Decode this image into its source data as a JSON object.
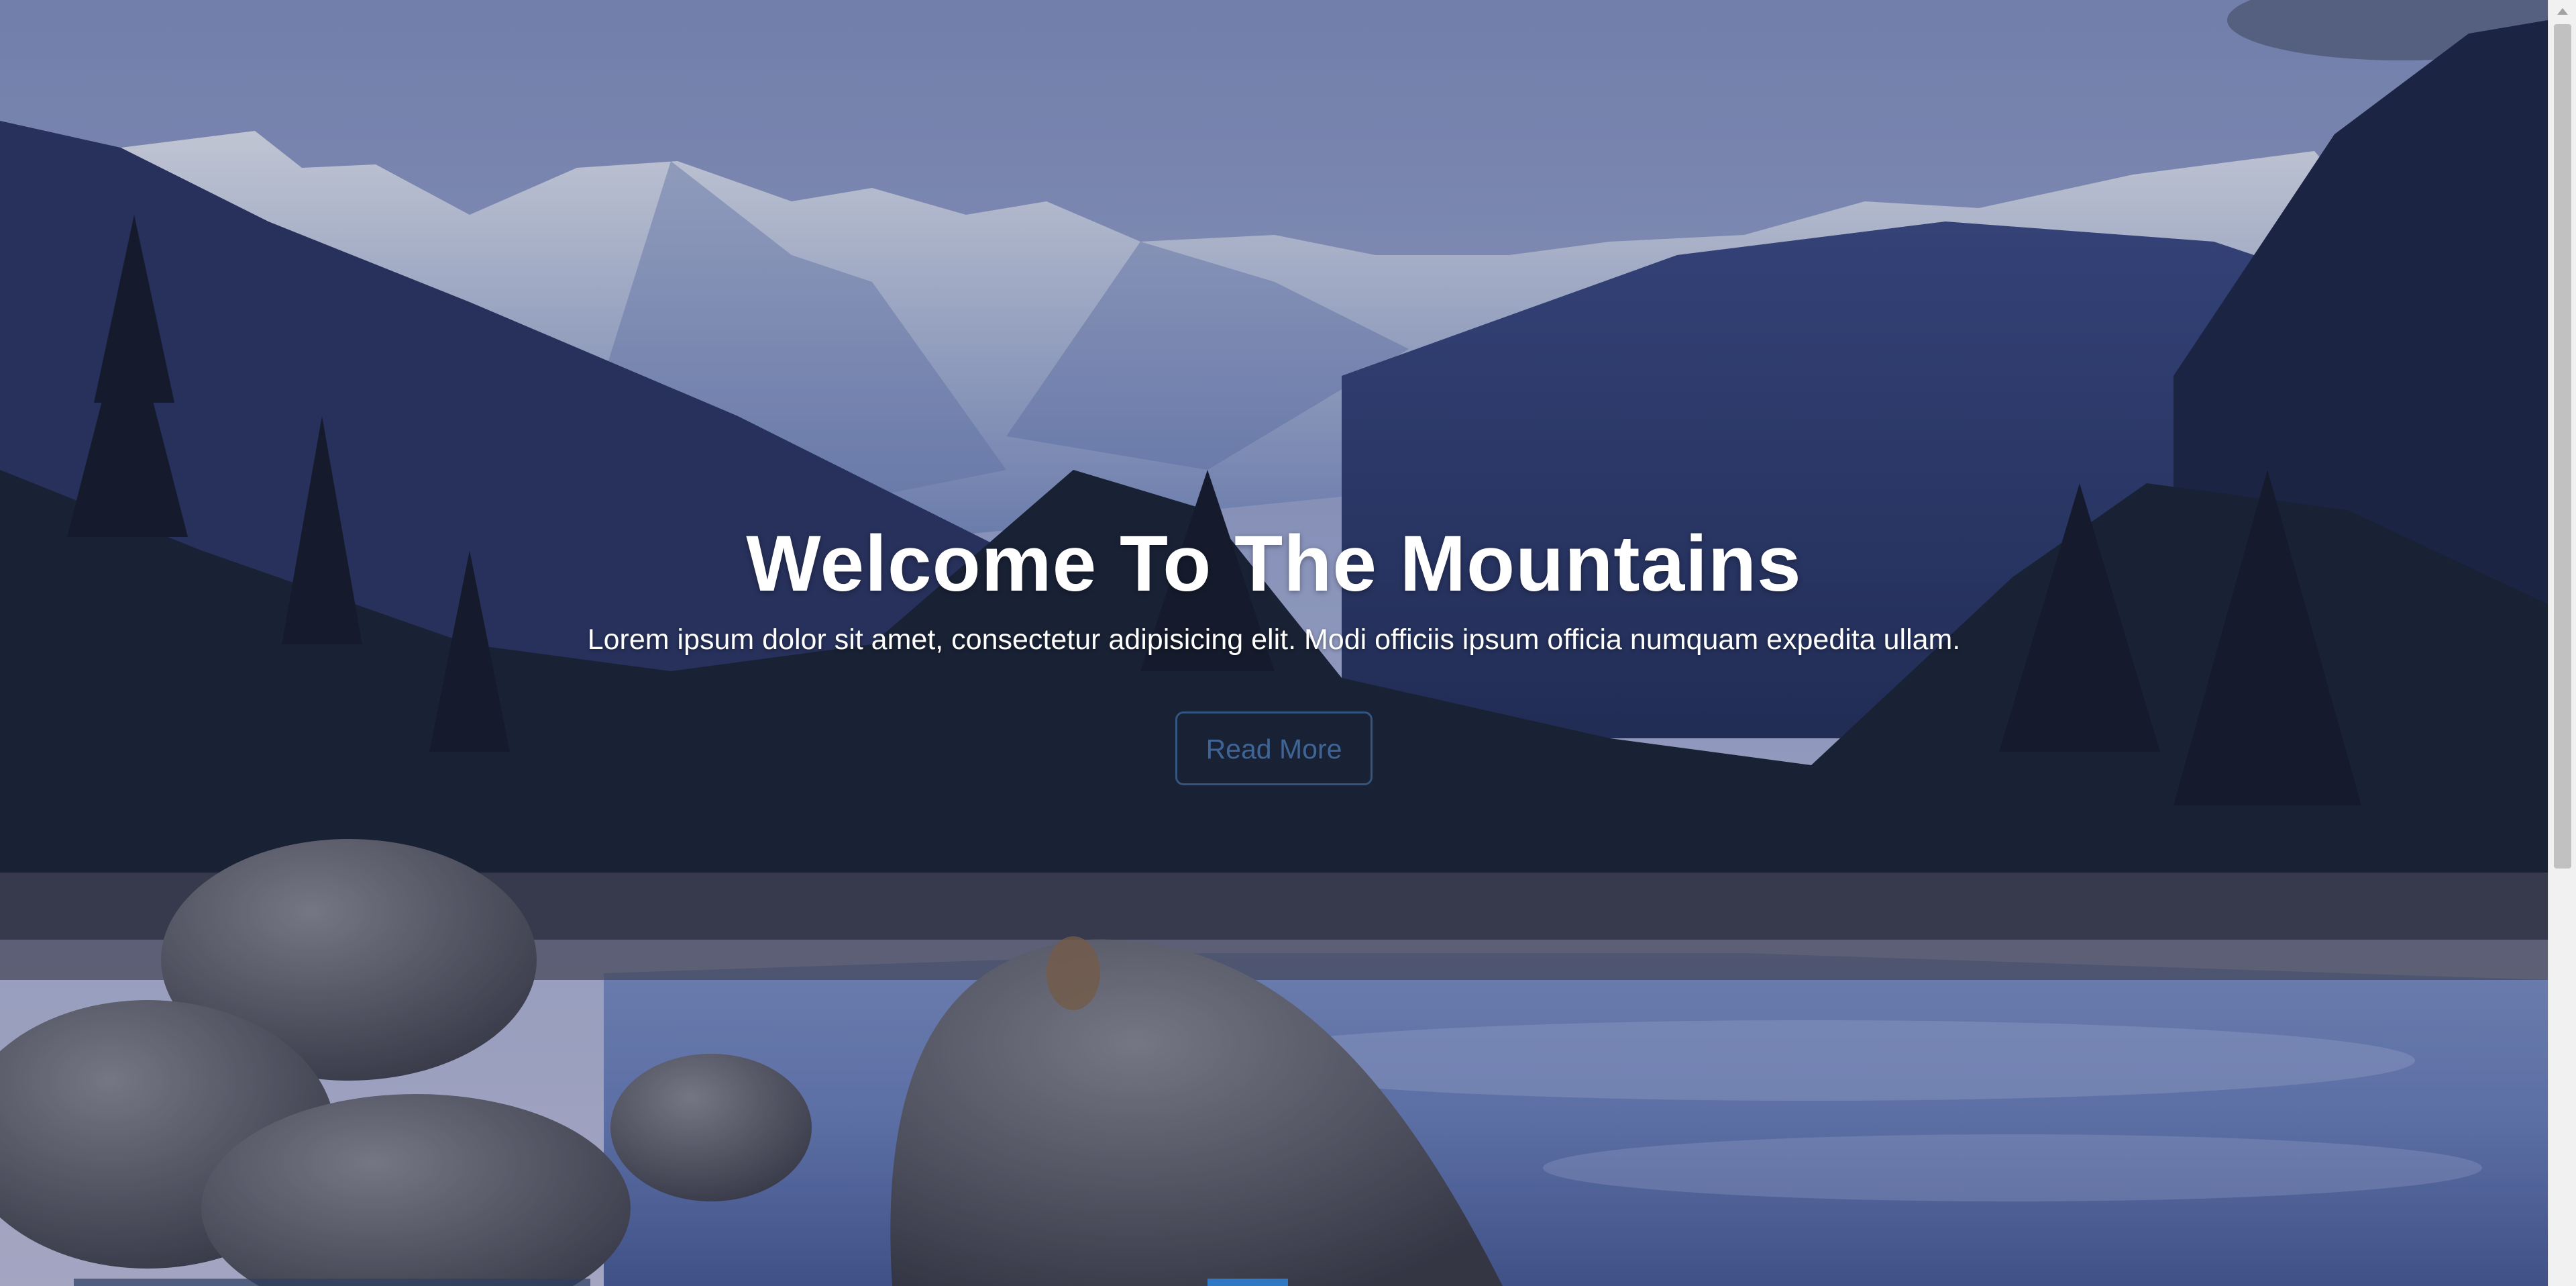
{
  "hero": {
    "title": "Welcome To The Mountains",
    "subtitle": "Lorem ipsum dolor sit amet, consectetur adipisicing elit. Modi officiis ipsum officia numquam expedita ullam.",
    "button_label": "Read More"
  },
  "colors": {
    "title": "#ffffff",
    "button_border": "#34557e",
    "button_text": "#3f6596"
  },
  "icons": {
    "scroll_up": "chevron-up-icon"
  }
}
